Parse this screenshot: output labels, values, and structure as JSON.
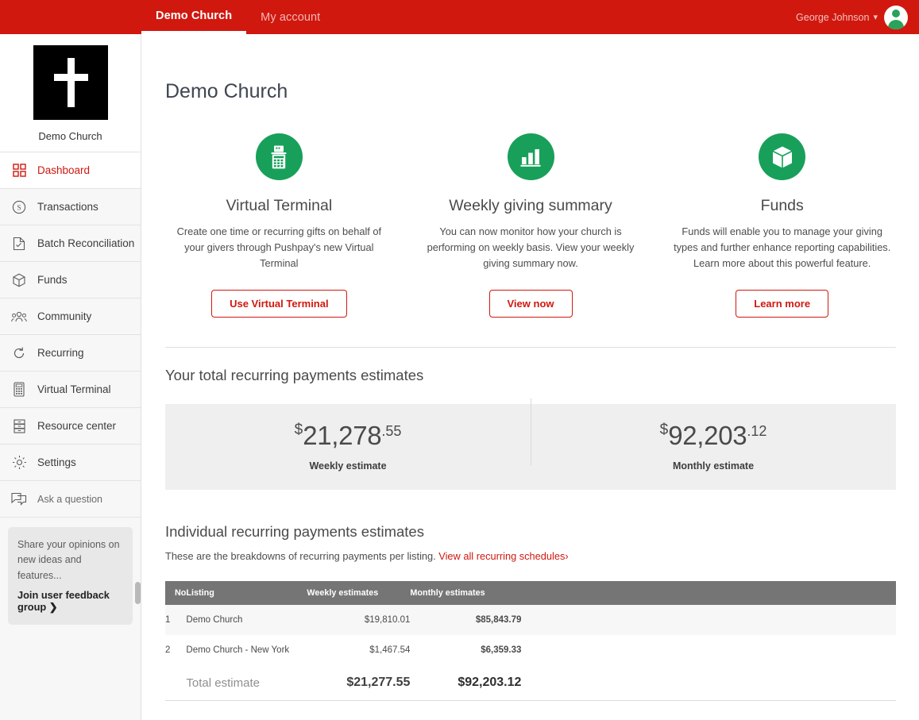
{
  "topbar": {
    "nav": [
      {
        "label": "Demo Church",
        "active": true
      },
      {
        "label": "My account",
        "active": false
      }
    ],
    "user": {
      "name": "George Johnson",
      "caret": "⌄"
    },
    "brand_color": "#d0180f"
  },
  "sidebar": {
    "brand": {
      "name": "Demo Church",
      "logo_icon": "cross-icon"
    },
    "items": [
      {
        "label": "Dashboard",
        "icon": "grid-icon",
        "active": true
      },
      {
        "label": "Transactions",
        "icon": "dollar-circle-icon",
        "active": false
      },
      {
        "label": "Batch Reconciliation",
        "icon": "document-check-icon",
        "active": false
      },
      {
        "label": "Funds",
        "icon": "cube-icon",
        "active": false
      },
      {
        "label": "Community",
        "icon": "people-icon",
        "active": false
      },
      {
        "label": "Recurring",
        "icon": "refresh-icon",
        "active": false
      },
      {
        "label": "Virtual Terminal",
        "icon": "card-terminal-icon",
        "active": false
      },
      {
        "label": "Resource center",
        "icon": "drawers-icon",
        "active": false
      },
      {
        "label": "Settings",
        "icon": "gear-icon",
        "active": false
      },
      {
        "label": "Ask a question",
        "icon": "chat-bubble-icon",
        "active": false
      }
    ],
    "feedback": {
      "text": "Share your opinions on new ideas and features...",
      "link": "Join user feedback group ❯"
    }
  },
  "main": {
    "page_title": "Demo Church",
    "cards": [
      {
        "icon": "card-terminal-icon",
        "title": "Virtual Terminal",
        "desc": "Create one time or recurring gifts on behalf of your givers through Pushpay's new Virtual Terminal",
        "button": "Use Virtual Terminal"
      },
      {
        "icon": "bar-chart-icon",
        "title": "Weekly giving summary",
        "desc": "You can now monitor how your church is performing on weekly basis. View your weekly giving summary now.",
        "button": "View now"
      },
      {
        "icon": "cube-icon",
        "title": "Funds",
        "desc": "Funds will enable you to manage your giving types and further enhance reporting capabilities. Learn more about this powerful feature.",
        "button": "Learn more"
      }
    ],
    "totals": {
      "heading": "Your total recurring payments estimates",
      "weekly": {
        "currency": "$",
        "integer": "21,278",
        "decimal": ".55",
        "label": "Weekly estimate"
      },
      "monthly": {
        "currency": "$",
        "integer": "92,203",
        "decimal": ".12",
        "label": "Monthly estimate"
      }
    },
    "individual": {
      "heading": "Individual recurring payments estimates",
      "note": "These are the breakdowns of recurring payments per listing. ",
      "link": "View all recurring schedules›",
      "columns": [
        "No",
        "Listing",
        "Weekly estimates",
        "Monthly estimates"
      ],
      "rows": [
        {
          "no": "1",
          "listing": "Demo Church",
          "weekly": "$19,810.01",
          "monthly": "$85,843.79"
        },
        {
          "no": "2",
          "listing": "Demo Church - New York",
          "weekly": "$1,467.54",
          "monthly": "$6,359.33"
        }
      ],
      "total": {
        "label": "Total estimate",
        "weekly": "$21,277.55",
        "monthly": "$92,203.12"
      }
    }
  },
  "colors": {
    "accent": "#d0180f",
    "green": "#18a05a",
    "header_gray": "#757575"
  }
}
